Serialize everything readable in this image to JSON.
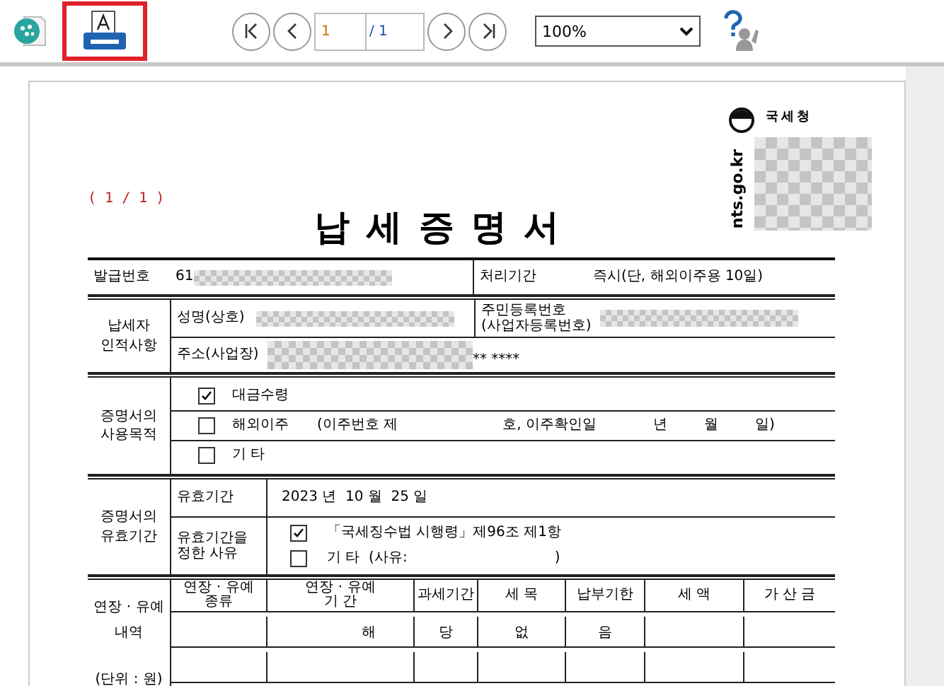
{
  "toolbar": {
    "print_button": {
      "selected": true
    },
    "page_input": "1",
    "page_total": "/ 1",
    "zoom": "100%"
  },
  "document": {
    "page_counter": "( 1 / 1 )",
    "title": "납세증명서",
    "logo": {
      "org": "국세청",
      "url": "nts.go.kr"
    },
    "issue": {
      "number_label": "발급번호",
      "number_prefix": "61",
      "processing_label": "처리기간",
      "processing_value": "즉시(단, 해외이주용 10일)"
    },
    "taxpayer": {
      "label_lines": [
        "납세자",
        "인적사항"
      ],
      "name_label": "성명(상호)",
      "id_label_lines": [
        "주민등록번호",
        "(사업자등록번호)"
      ],
      "address_label": "주소(사업장)",
      "address_suffix": "** ****"
    },
    "purpose": {
      "label_lines": [
        "증명서의",
        "사용목적"
      ],
      "options": [
        {
          "label": "대금수령",
          "checked": true
        },
        {
          "label": "해외이주",
          "checked": false,
          "details": [
            "(이주번호 제",
            "호, 이주확인일",
            "년",
            "월",
            "일)"
          ]
        },
        {
          "label": "기 타",
          "checked": false
        }
      ]
    },
    "validity": {
      "label_lines": [
        "증명서의",
        "유효기간"
      ],
      "period_label": "유효기간",
      "period_value": "2023 년  10 월  25 일",
      "reason_label_lines": [
        "유효기간을",
        "정한 사유"
      ],
      "reasons": [
        {
          "text": "「국세징수법 시행령」제96조 제1항",
          "checked": true
        },
        {
          "text": "기 타  (사유:",
          "closing": ")",
          "checked": false
        }
      ]
    },
    "extension": {
      "label_lines": [
        "연장 · 유예",
        "내역"
      ],
      "unit": "(단위 : 원)",
      "columns": [
        "연장 · 유예\n종류",
        "연장 · 유예\n기 간",
        "과세기간",
        "세 목",
        "납부기한",
        "세 액",
        "가 산 금"
      ],
      "rows": [
        [
          null,
          "해",
          "당",
          "없",
          "음",
          null,
          null
        ],
        [
          null,
          null,
          null,
          null,
          null,
          null,
          null
        ]
      ]
    }
  }
}
